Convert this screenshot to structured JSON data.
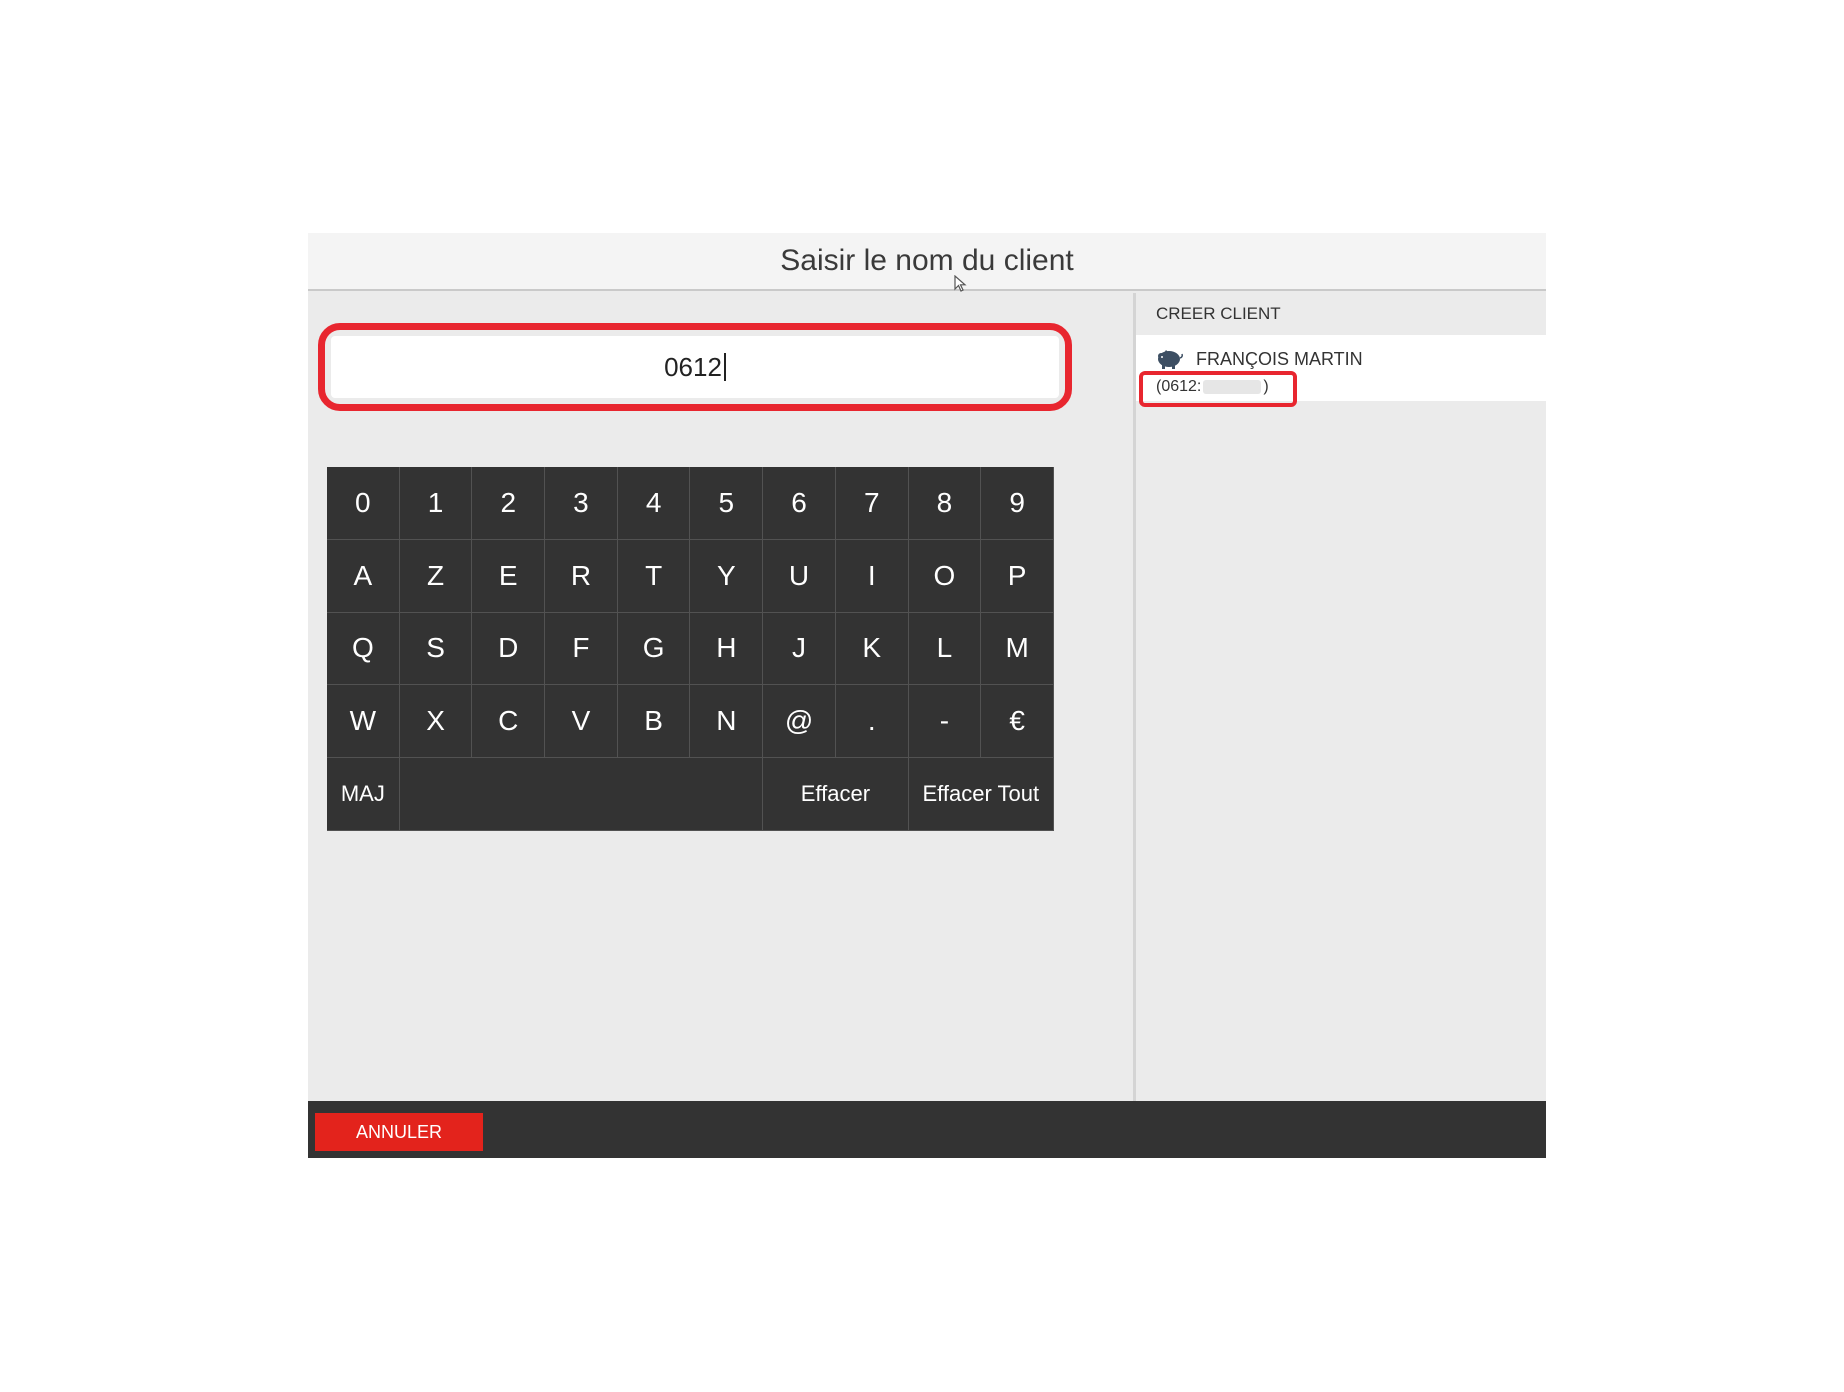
{
  "dialog": {
    "title": "Saisir le nom du client"
  },
  "search": {
    "value": "0612"
  },
  "keyboard": {
    "row1": [
      "0",
      "1",
      "2",
      "3",
      "4",
      "5",
      "6",
      "7",
      "8",
      "9"
    ],
    "row2": [
      "A",
      "Z",
      "E",
      "R",
      "T",
      "Y",
      "U",
      "I",
      "O",
      "P"
    ],
    "row3": [
      "Q",
      "S",
      "D",
      "F",
      "G",
      "H",
      "J",
      "K",
      "L",
      "M"
    ],
    "row4": [
      "W",
      "X",
      "C",
      "V",
      "B",
      "N",
      "@",
      ".",
      "-",
      "€"
    ],
    "shift_label": "MAJ",
    "delete_label": "Effacer",
    "clear_all_label": "Effacer Tout"
  },
  "clients": {
    "create_label": "CREER CLIENT",
    "results": [
      {
        "name": "FRANÇOIS MARTIN",
        "phone_prefix": "(0612:",
        "phone_suffix": ")"
      }
    ]
  },
  "footer": {
    "cancel_label": "ANNULER"
  },
  "colors": {
    "highlight": "#e8262f",
    "keyboard_bg": "#333333",
    "cancel_bg": "#e3231c"
  }
}
